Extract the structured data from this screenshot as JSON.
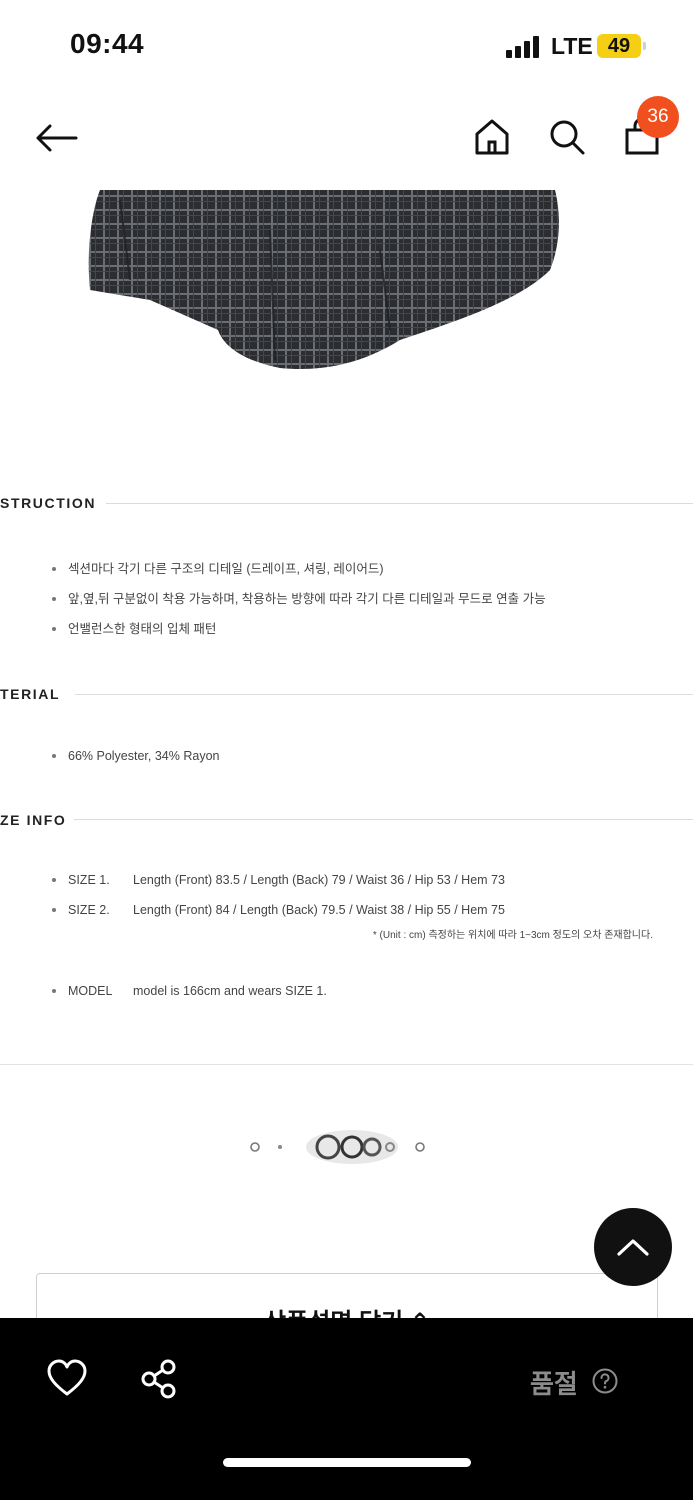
{
  "status_bar": {
    "time": "09:44",
    "network": "LTE",
    "battery": "49"
  },
  "nav": {
    "cart_count": "36"
  },
  "sections": {
    "construction": {
      "title": "STRUCTION",
      "items": [
        "섹션마다 각기 다른 구조의 디테일 (드레이프, 셔링, 레이어드)",
        "앞,옆,뒤 구분없이 착용 가능하며, 착용하는 방향에 따라 각기 다른 디테일과 무드로 연출 가능",
        "언밸런스한 형태의 입체 패턴"
      ]
    },
    "material": {
      "title": "TERIAL",
      "items": [
        "66% Polyester, 34% Rayon"
      ]
    },
    "size_info": {
      "title": "ZE INFO",
      "sizes": [
        {
          "key": "SIZE 1.",
          "value": "Length (Front) 83.5 / Length (Back) 79 / Waist 36 / Hip 53 / Hem 73"
        },
        {
          "key": "SIZE 2.",
          "value": "Length (Front) 84 / Length (Back) 79.5 / Waist 38 / Hip 55 / Hem 75"
        }
      ],
      "note": "* (Unit : cm) 측정하는 위치에 따라 1~3cm 정도의 오차 존재합니다.",
      "model": {
        "key": "MODEL",
        "value": "model is 166cm and wears SIZE 1."
      }
    }
  },
  "collapse_button_label": "상품설명 닫기 ⌃",
  "bottom_bar": {
    "status_label": "품절"
  },
  "colors": {
    "badge": "#f1501e",
    "battery": "#f5cf14",
    "bottom_bar": "#000000",
    "soldout_text": "#8c8c8c"
  }
}
